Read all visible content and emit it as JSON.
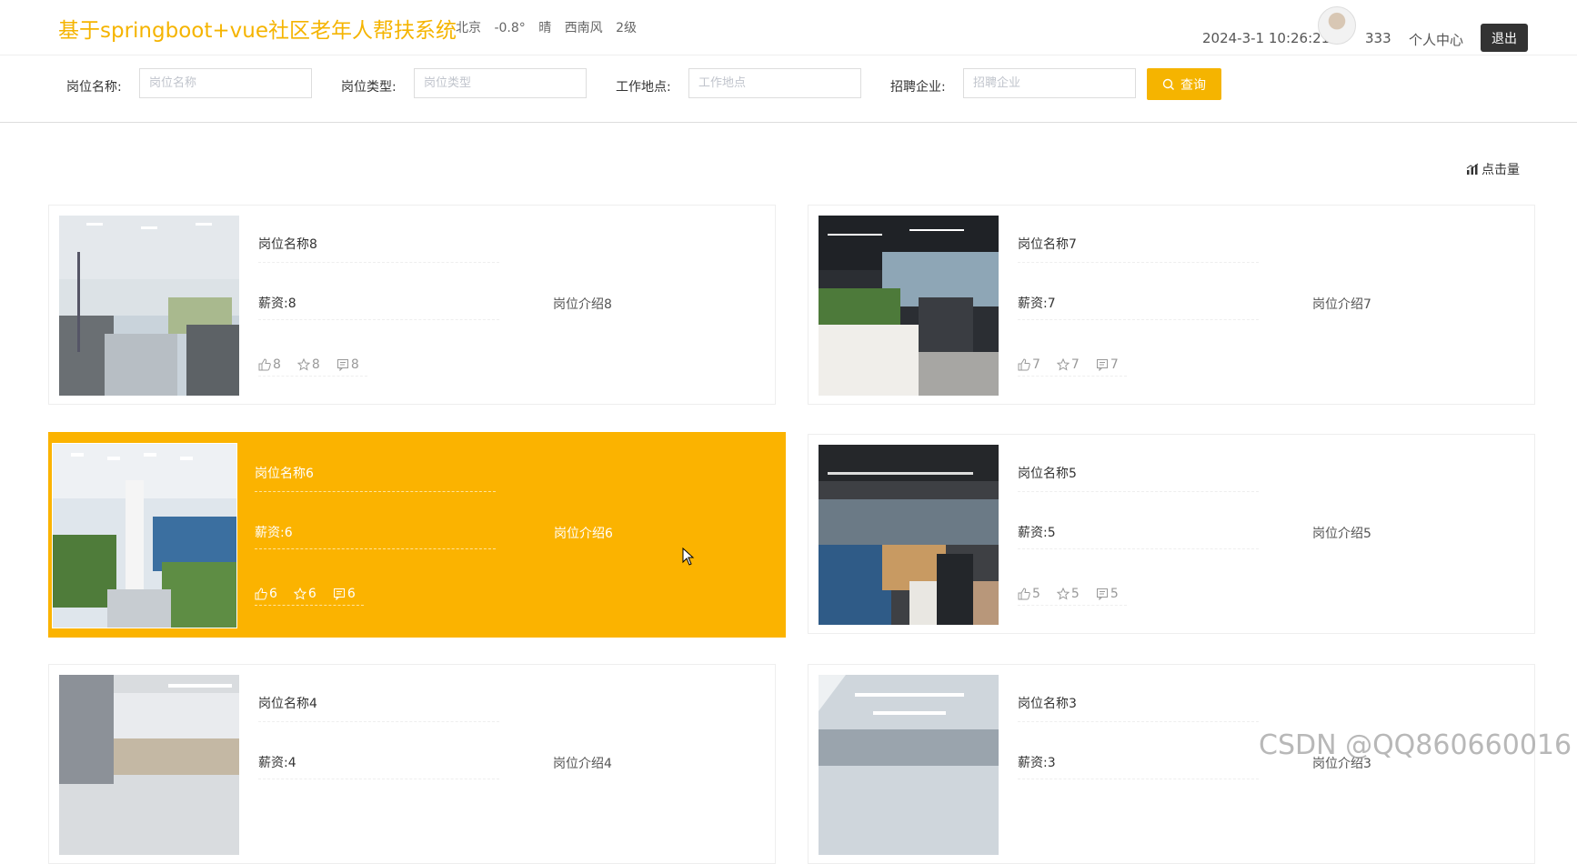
{
  "header": {
    "title": "基于springboot+vue社区老年人帮扶系统",
    "weather": {
      "city": "北京",
      "temp": "-0.8°",
      "condition": "晴",
      "wind": "西南风",
      "level": "2级"
    },
    "datetime": "2024-3-1 10:26:21",
    "username": "333",
    "profile_label": "个人中心",
    "logout_label": "退出"
  },
  "search": {
    "fields": [
      {
        "label": "岗位名称:",
        "placeholder": "岗位名称"
      },
      {
        "label": "岗位类型:",
        "placeholder": "岗位类型"
      },
      {
        "label": "工作地点:",
        "placeholder": "工作地点"
      },
      {
        "label": "招聘企业:",
        "placeholder": "招聘企业"
      }
    ],
    "button_label": "查询"
  },
  "sort_label": "点击量",
  "jobs": [
    {
      "name": "岗位名称8",
      "salary": "薪资:8",
      "intro": "岗位介绍8",
      "likes": "8",
      "favorites": "8",
      "comments": "8"
    },
    {
      "name": "岗位名称7",
      "salary": "薪资:7",
      "intro": "岗位介绍7",
      "likes": "7",
      "favorites": "7",
      "comments": "7"
    },
    {
      "name": "岗位名称6",
      "salary": "薪资:6",
      "intro": "岗位介绍6",
      "likes": "6",
      "favorites": "6",
      "comments": "6"
    },
    {
      "name": "岗位名称5",
      "salary": "薪资:5",
      "intro": "岗位介绍5",
      "likes": "5",
      "favorites": "5",
      "comments": "5"
    },
    {
      "name": "岗位名称4",
      "salary": "薪资:4",
      "intro": "岗位介绍4"
    },
    {
      "name": "岗位名称3",
      "salary": "薪资:3",
      "intro": "岗位介绍3"
    }
  ],
  "watermark": "CSDN @QQ860660016",
  "colors": {
    "accent": "#f5b400",
    "active_card": "#fbb300",
    "logout_bg": "#333333"
  }
}
